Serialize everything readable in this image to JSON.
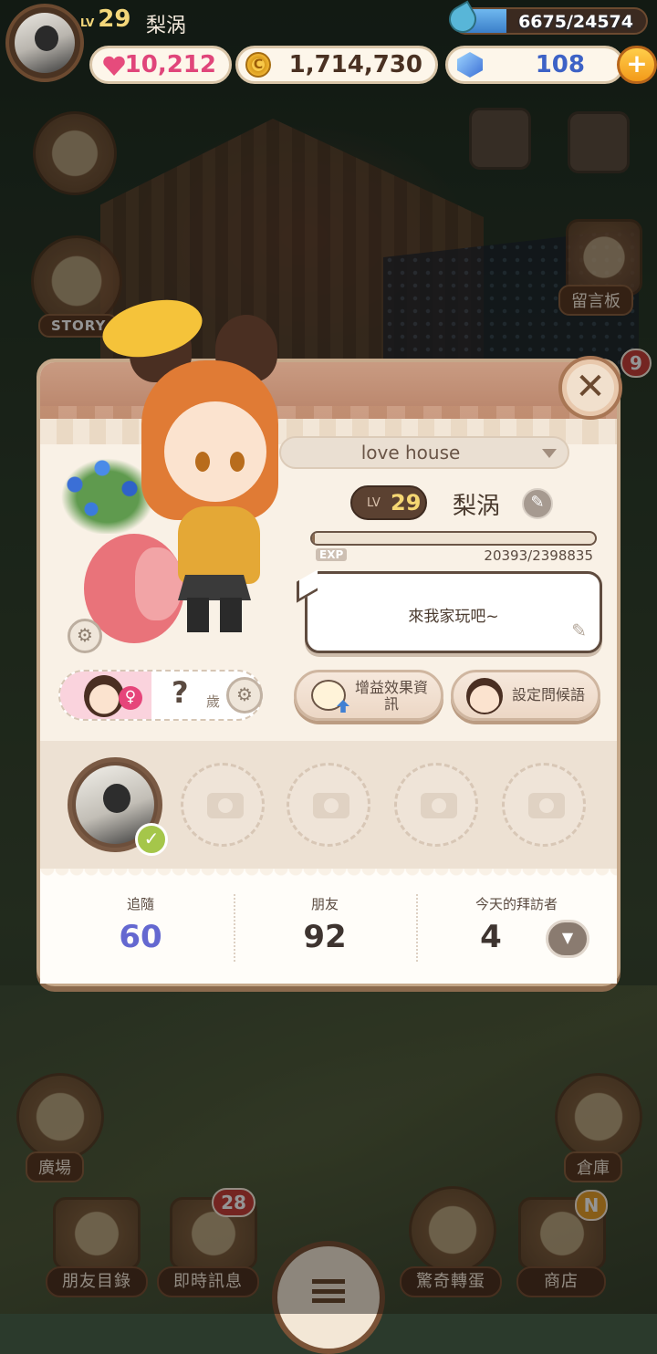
{
  "top_hud": {
    "level_tag": "LV",
    "level": "29",
    "player_name": "梨涡",
    "energy": "6675/24574",
    "energy_fraction": 0.27,
    "hearts": "10,212",
    "coins": "1,714,730",
    "coin_symbol": "C",
    "gems": "108",
    "plus_symbol": "+"
  },
  "side_buttons": {
    "story_label": "STORY",
    "board_label": "留言板",
    "board_badge": "9",
    "plaza_label": "廣場",
    "warehouse_label": "倉庫"
  },
  "bottom_nav": {
    "friends_list": "朋友目錄",
    "instant_message": "即時訊息",
    "instant_message_badge": "28",
    "surprise_egg": "驚奇轉蛋",
    "shop": "商店",
    "shop_badge": "N"
  },
  "profile": {
    "close_symbol": "✕",
    "house_name": "love house",
    "level_tag": "LV",
    "level": "29",
    "name": "梨涡",
    "exp_tag": "EXP",
    "exp_text": "20393/2398835",
    "exp_fraction": 0.0085,
    "message": "來我家玩吧~",
    "buff_button": "增益效果資訊",
    "greeting_button": "設定問候語",
    "gender_symbol": "♀",
    "age": "?",
    "age_unit": "歲",
    "stats": {
      "following_label": "追隨",
      "following": "60",
      "friends_label": "朋友",
      "friends": "92",
      "visitors_label": "今天的拜訪者",
      "visitors": "4"
    }
  },
  "colors": {
    "following_accent": "#6468d0",
    "hearts_accent": "#e0457a",
    "gems_accent": "#3d62c6"
  }
}
